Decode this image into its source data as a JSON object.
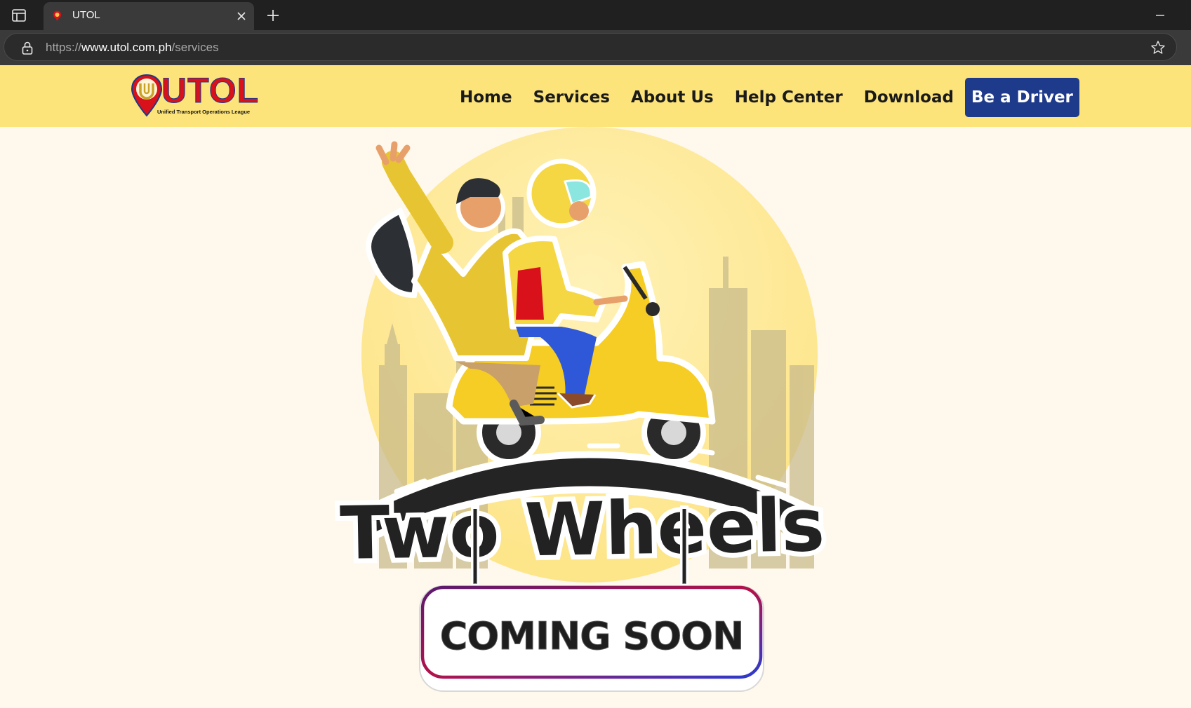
{
  "browser": {
    "tab_title": "UTOL",
    "url_scheme": "https://",
    "url_host": "www.utol.com.ph",
    "url_path": "/services"
  },
  "site": {
    "logo_word": "UTOL",
    "logo_tagline": "Unified Transport Operations League",
    "nav": {
      "home": "Home",
      "services": "Services",
      "about": "About Us",
      "help": "Help Center",
      "download": "Download",
      "cta": "Be a Driver"
    },
    "colors": {
      "header_bg": "#fde47a",
      "page_bg": "#fff8ec",
      "cta_bg": "#1e3a8a",
      "brand_red": "#d8111b"
    }
  },
  "hero": {
    "headline": "Two Wheels",
    "badge": "COMING SOON"
  },
  "icons": {
    "sidebar": "sidebar-toggle-icon",
    "close": "close-icon",
    "new_tab": "plus-icon",
    "minimize": "minimize-icon",
    "lock": "lock-icon",
    "bookmark": "star-icon"
  }
}
